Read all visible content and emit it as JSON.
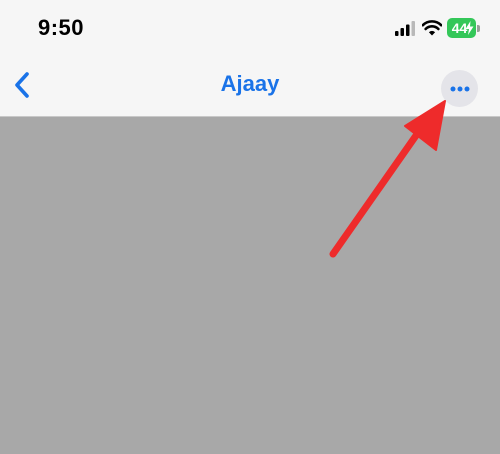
{
  "status_bar": {
    "time": "9:50",
    "battery_level": "44"
  },
  "nav_bar": {
    "title": "Ajaay"
  },
  "colors": {
    "accent": "#1a73e8",
    "battery": "#34c759",
    "annotation_arrow": "#ee2b2b",
    "content_background": "#a8a8a8"
  },
  "icons": {
    "back": "chevron-left-icon",
    "more": "ellipsis-icon",
    "cellular": "cellular-signal-icon",
    "wifi": "wifi-icon",
    "battery": "battery-icon"
  }
}
